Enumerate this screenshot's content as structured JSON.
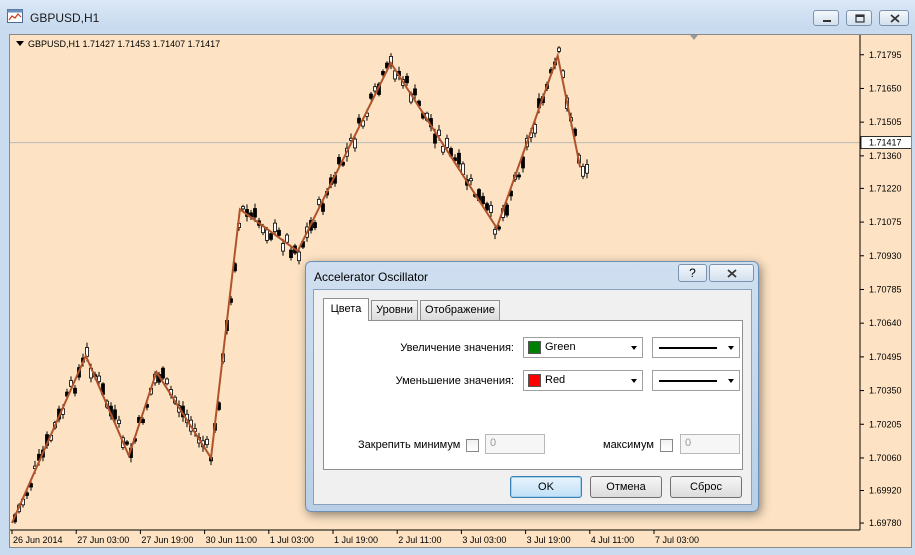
{
  "window": {
    "title": "GBPUSD,H1"
  },
  "chart": {
    "header": "GBPUSD,H1  1.71427 1.71453 1.71407 1.71417",
    "current_price": "1.71417",
    "price_labels": [
      "1.71795",
      "1.71650",
      "1.71505",
      "1.71360",
      "1.71220",
      "1.71075",
      "1.70930",
      "1.70785",
      "1.70640",
      "1.70495",
      "1.70350",
      "1.70205",
      "1.70060",
      "1.69920",
      "1.69780"
    ],
    "time_labels": [
      "26 Jun 2014",
      "27 Jun 03:00",
      "27 Jun 19:00",
      "30 Jun 11:00",
      "1 Jul 03:00",
      "1 Jul 19:00",
      "2 Jul 11:00",
      "3 Jul 03:00",
      "3 Jul 19:00",
      "4 Jul 11:00",
      "7 Jul 03:00"
    ],
    "colors": {
      "background": "#fde3c4",
      "zigzag": "#b0532a",
      "candles": "#000000",
      "price_line": "#b8b8b8"
    }
  },
  "chart_data": {
    "type": "line",
    "title": "",
    "xlabel": "",
    "ylabel": "",
    "ylim": [
      1.6975,
      1.7188
    ],
    "x": [
      "26 Jun 2014",
      "27 Jun 03:00",
      "27 Jun 19:00",
      "30 Jun 11:00",
      "1 Jul 03:00",
      "1 Jul 19:00",
      "2 Jul 11:00",
      "3 Jul 03:00",
      "3 Jul 19:00",
      "4 Jul 11:00",
      "7 Jul 03:00"
    ],
    "series": [
      {
        "points": [
          [
            0.0,
            1.6978
          ],
          [
            1.15,
            1.705
          ],
          [
            1.82,
            1.7007
          ],
          [
            2.25,
            1.7043
          ],
          [
            3.1,
            1.7006
          ],
          [
            3.55,
            1.7113
          ],
          [
            4.45,
            1.7095
          ],
          [
            5.9,
            1.7176
          ],
          [
            7.55,
            1.7105
          ],
          [
            8.5,
            1.7179
          ],
          [
            8.85,
            1.7131
          ]
        ]
      }
    ],
    "grid": false,
    "legend": "none"
  },
  "dialog": {
    "title": "Accelerator Oscillator",
    "help": "?",
    "tabs": [
      "Цвета",
      "Уровни",
      "Отображение"
    ],
    "active_tab": 0,
    "increase_label": "Увеличение значения:",
    "increase_color_name": "Green",
    "increase_color": "#008000",
    "decrease_label": "Уменьшение значения:",
    "decrease_color_name": "Red",
    "decrease_color": "#ff0000",
    "fix_min_label": "Закрепить минимум",
    "fix_min_value": "0",
    "max_label": "максимум",
    "max_value": "0",
    "ok": "OK",
    "cancel": "Отмена",
    "reset": "Сброс"
  }
}
